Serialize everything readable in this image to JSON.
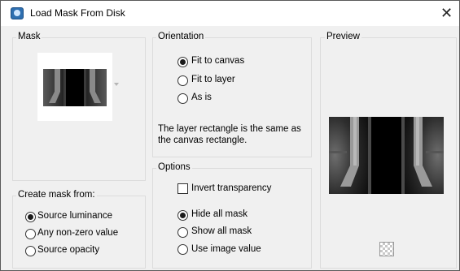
{
  "window": {
    "title": "Load Mask From Disk",
    "close_glyph": "✕",
    "app_icon": "psp-icon"
  },
  "mask_group": {
    "label": "Mask",
    "thumbnail": "mask-preview-image"
  },
  "create_from": {
    "label": "Create mask from:",
    "options": [
      {
        "label": "Source luminance",
        "checked": true
      },
      {
        "label": "Any non-zero value",
        "checked": false
      },
      {
        "label": "Source opacity",
        "checked": false
      }
    ]
  },
  "orientation": {
    "label": "Orientation",
    "options": [
      {
        "label": "Fit to canvas",
        "checked": true
      },
      {
        "label": "Fit to layer",
        "checked": false
      },
      {
        "label": "As is",
        "checked": false
      }
    ],
    "info": "The layer rectangle is the same as the canvas rectangle."
  },
  "options": {
    "label": "Options",
    "invert_label": "Invert transparency",
    "invert_checked": false,
    "radios": [
      {
        "label": "Hide all mask",
        "checked": true
      },
      {
        "label": "Show all mask",
        "checked": false
      },
      {
        "label": "Use image value",
        "checked": false
      }
    ]
  },
  "preview": {
    "label": "Preview",
    "transparency_icon": "checkerboard-icon"
  }
}
